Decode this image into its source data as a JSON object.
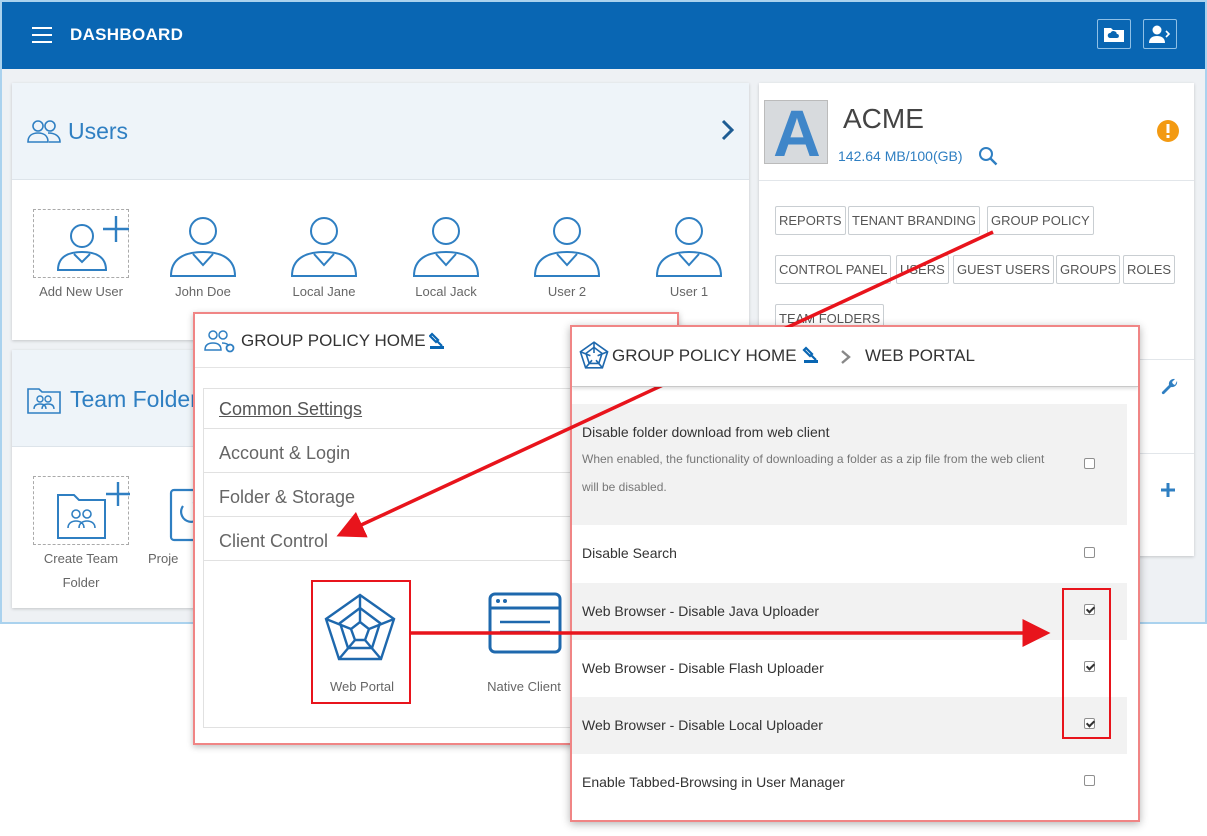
{
  "header": {
    "title": "DASHBOARD"
  },
  "users_card": {
    "title": "Users",
    "tiles": [
      "Add New User",
      "John Doe",
      "Local Jane",
      "Local Jack",
      "User 2",
      "User 1"
    ]
  },
  "team_folders_card": {
    "title": "Team Folders",
    "tiles": [
      "Create Team Folder",
      "Proje"
    ]
  },
  "tenant": {
    "logo_letter": "A",
    "name": "ACME",
    "storage": "142.64 MB/100(GB)",
    "tags": [
      "REPORTS",
      "TENANT BRANDING",
      "GROUP POLICY",
      "CONTROL PANEL",
      "USERS",
      "GUEST USERS",
      "GROUPS",
      "ROLES",
      "TEAM FOLDERS"
    ]
  },
  "group_policy_home": {
    "title": "GROUP POLICY HOME",
    "menu": [
      "Common Settings",
      "Account & Login",
      "Folder & Storage",
      "Client Control"
    ],
    "icons": [
      "Web Portal",
      "Native Client"
    ]
  },
  "web_portal": {
    "crumb_home": "GROUP POLICY HOME",
    "crumb_current": "WEB PORTAL",
    "options": [
      {
        "label": "Disable folder download from web client",
        "description": "When enabled, the functionality of downloading a folder as a zip file from the web client will be disabled.",
        "checked": false
      },
      {
        "label": "Disable Search",
        "checked": false
      },
      {
        "label": "Web Browser - Disable Java Uploader",
        "checked": true
      },
      {
        "label": "Web Browser - Disable Flash Uploader",
        "checked": true
      },
      {
        "label": "Web Browser - Disable Local Uploader",
        "checked": true
      },
      {
        "label": "Enable Tabbed-Browsing in User Manager",
        "checked": false
      }
    ]
  },
  "colors": {
    "brand": "#0966b3",
    "accent": "#2f7fc2",
    "warning": "#f39a12",
    "arrow": "#e8141c"
  }
}
